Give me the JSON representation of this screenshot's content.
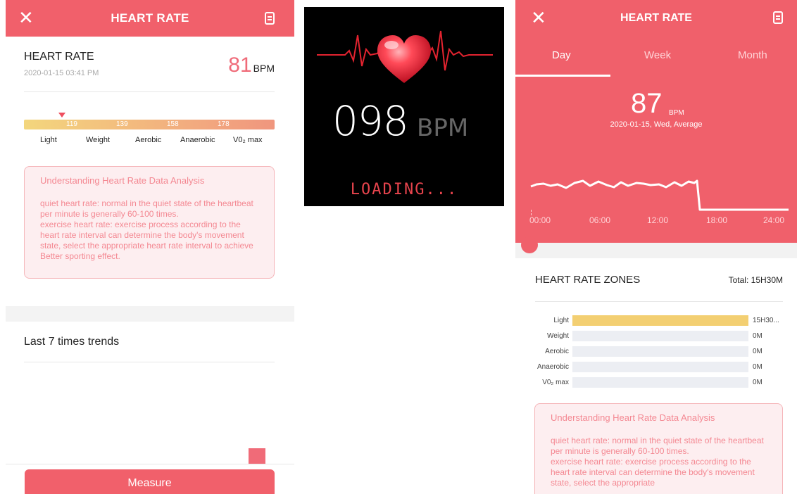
{
  "left": {
    "header": {
      "title": "HEART RATE",
      "close_icon": "close-icon",
      "doc_icon": "document-icon"
    },
    "heart_rate": {
      "label": "HEART RATE",
      "date": "2020-01-15 03:41 PM",
      "value": "81",
      "unit": "BPM"
    },
    "zone_scale": {
      "ticks": [
        "119",
        "139",
        "158",
        "178"
      ],
      "labels": [
        "Light",
        "Weight",
        "Aerobic",
        "Anaerobic",
        "V0₂ max"
      ],
      "colors": {
        "start": "#f3d67d",
        "end": "#f0967e",
        "marker": "#ef4f5f"
      }
    },
    "info": {
      "title": "Understanding Heart Rate Data Analysis",
      "body": "quiet heart rate: normal in the quiet state of the heartbeat per minute is generally 60-100 times.\n exercise heart rate: exercise process according to the heart rate interval can determine the body's movement state, select the appropriate heart rate interval to achieve Better sporting effect."
    },
    "trends_title": "Last 7 times trends",
    "measure_label": "Measure"
  },
  "middle": {
    "bpm_value": "098",
    "bpm_unit": "BPM",
    "loading": "LOADING..."
  },
  "right": {
    "header": {
      "title": "HEART RATE",
      "close_icon": "close-icon",
      "doc_icon": "document-icon"
    },
    "tabs": [
      {
        "label": "Day",
        "active": true
      },
      {
        "label": "Week",
        "active": false
      },
      {
        "label": "Month",
        "active": false
      }
    ],
    "summary": {
      "value": "87",
      "unit": "BPM",
      "caption": "2020-01-15, Wed, Average"
    },
    "time_ticks": [
      "00:00",
      "06:00",
      "12:00",
      "18:00",
      "24:00"
    ],
    "zones": {
      "title": "HEART RATE ZONES",
      "total": "Total: 15H30M",
      "rows": [
        {
          "label": "Light",
          "value": "15H30...",
          "fill": 1.0
        },
        {
          "label": "Weight",
          "value": "0M",
          "fill": 0
        },
        {
          "label": "Aerobic",
          "value": "0M",
          "fill": 0
        },
        {
          "label": "Anaerobic",
          "value": "0M",
          "fill": 0
        },
        {
          "label": "V0₂ max",
          "value": "0M",
          "fill": 0
        }
      ]
    },
    "info": {
      "title": "Understanding Heart Rate Data Analysis",
      "body": "quiet heart rate: normal in the quiet state of the heartbeat per minute is generally 60-100 times.\n exercise heart rate: exercise process according to the heart rate interval can determine the body's movement state, select the appropriate"
    }
  },
  "colors": {
    "accent": "#f1606b",
    "info_text": "#f48892",
    "info_bg": "#fdeef0"
  }
}
